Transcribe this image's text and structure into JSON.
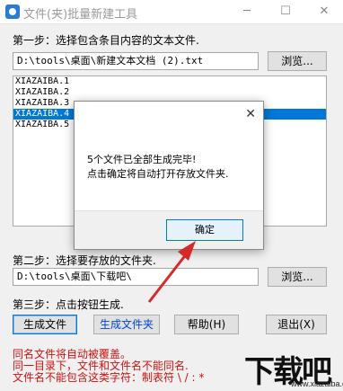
{
  "window": {
    "title": "文件(夹)批量新建工具",
    "minimize": "─",
    "maximize": "☐",
    "close": "✕"
  },
  "step1": {
    "label": "第一步：选择包含条目内容的文本文件.",
    "path": "D:\\tools\\桌面\\新建文本文档 (2).txt",
    "browse_label": "浏览..."
  },
  "list": {
    "items": [
      "XIAZAIBA.1",
      "XIAZAIBA.2",
      "XIAZAIBA.3",
      "XIAZAIBA.4",
      "XIAZAIBA.5"
    ],
    "selected_index": 3
  },
  "step2": {
    "label": "第二步：选择要存放的文件夹.",
    "path": "D:\\tools\\桌面\\下载吧\\",
    "browse_label": "浏览..."
  },
  "step3": {
    "label": "第三步：点击按钮生成.",
    "gen_files": "生成文件",
    "gen_folders": "生成文件夹",
    "help": "帮助(H)",
    "exit": "退出(X)"
  },
  "notes": [
    "同名文件将自动被覆盖。",
    "同一目录下，文件和文件名不能同名.",
    "文件名不能包含这类字符：制表符 \\ / : *"
  ],
  "dialog": {
    "close": "✕",
    "line1": "5个文件已全部生成完毕!",
    "line2": "点击确定将自动打开存放文件夹.",
    "ok_label": "确定"
  },
  "watermark": {
    "text": "下载吧",
    "url": "www.xiazaiba.com"
  },
  "colors": {
    "selection": "#0078d7",
    "note_text": "#d01010",
    "arrow": "#d42a2a",
    "accent_link": "#0044cc"
  }
}
